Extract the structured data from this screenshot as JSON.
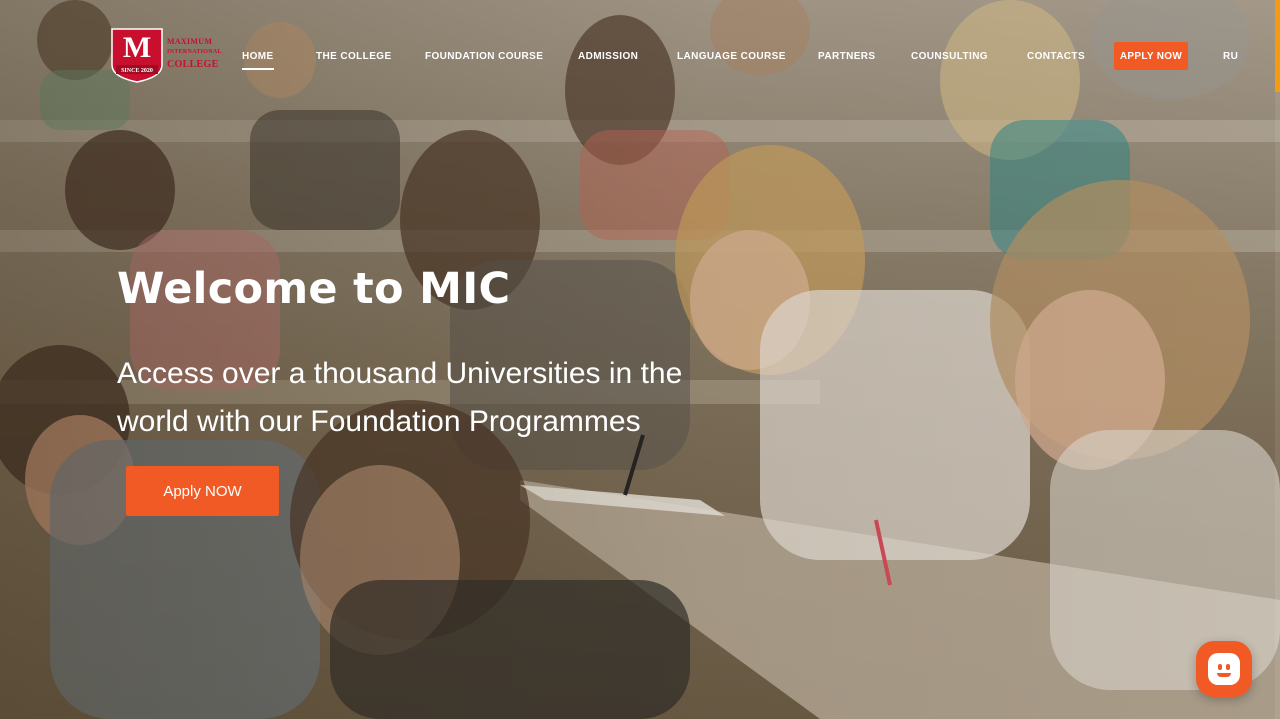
{
  "brand": {
    "badge_letter": "M",
    "line1": "MAXIMUM",
    "line2": "INTERNATIONAL",
    "line3": "COLLEGE",
    "since": "SINCE 2020",
    "colors": {
      "primary": "#c8102e",
      "accent": "#f15a24"
    }
  },
  "nav": {
    "items": [
      {
        "label": "HOME",
        "active": true
      },
      {
        "label": "THE COLLEGE"
      },
      {
        "label": "FOUNDATION COURSE"
      },
      {
        "label": "ADMISSION"
      },
      {
        "label": "LANGUAGE COURSE"
      },
      {
        "label": "PARTNERS"
      },
      {
        "label": "COUNSULTING"
      },
      {
        "label": "CONTACTS"
      }
    ],
    "apply_label": "APPLY NOW",
    "lang": "RU"
  },
  "hero": {
    "title": "Welcome to MIC",
    "subtitle": "Access over a thousand Universities in the world with our Foundation Programmes",
    "cta_label": "Apply NOW",
    "background": "students-writing-exam-photo"
  },
  "widgets": {
    "chat_icon": "chat-bubble-icon",
    "scroll_indicator_color": "#f39c12"
  }
}
